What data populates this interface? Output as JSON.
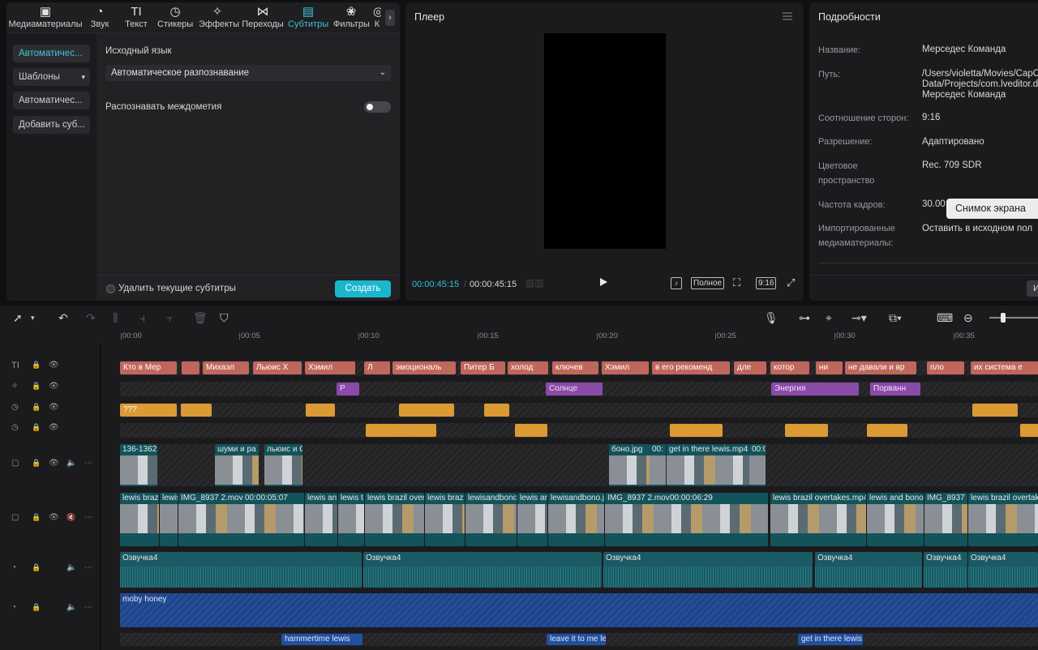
{
  "media_tabs": [
    {
      "label": "Медиаматериалы",
      "icon": "media-icon"
    },
    {
      "label": "Звук",
      "icon": "audio-icon"
    },
    {
      "label": "Текст",
      "icon": "text-icon"
    },
    {
      "label": "Стикеры",
      "icon": "sticker-icon"
    },
    {
      "label": "Эффекты",
      "icon": "effects-icon"
    },
    {
      "label": "Переходы",
      "icon": "transitions-icon"
    },
    {
      "label": "Субтитры",
      "icon": "captions-icon"
    },
    {
      "label": "Фильтры",
      "icon": "filters-icon"
    },
    {
      "label": "К",
      "icon": "more-icon"
    }
  ],
  "side_buttons": [
    "Автоматичес...",
    "Шаблоны",
    "Автоматичес...",
    "Добавить суб..."
  ],
  "captions": {
    "source_lang_label": "Исходный язык",
    "source_lang_value": "Автоматическое разпознавание",
    "interjections_label": "Распознавать междометия",
    "delete_label": "Удалить текущие субтитры",
    "create_label": "Создать"
  },
  "player": {
    "title": "Плеер",
    "time_current": "00:00:45:15",
    "time_total": "00:00:45:15",
    "full_label": "Полное",
    "ratio_label": "9:16"
  },
  "details": {
    "title": "Подробности",
    "rows": [
      {
        "label": "Название:",
        "value": "Мерседес Команда"
      },
      {
        "label": "Путь:",
        "value": "/Users/violetta/Movies/CapC"
      },
      {
        "label": "Соотношение сторон:",
        "value": "9:16"
      },
      {
        "label": "Разрешение:",
        "value": "Адаптировано"
      },
      {
        "label": "Цветовое пространство",
        "value": "Rec. 709 SDR"
      },
      {
        "label": "Частота кадров:",
        "value": "30.00"
      },
      {
        "label": "Импортированные медиаматериалы:",
        "value": "Оставить в исходном пол"
      }
    ],
    "path_line2": "Data/Projects/com.lveditor.d",
    "path_line3": "Мерседес Команда",
    "tooltip": "Снимок экрана",
    "footer_btn": "И"
  },
  "ruler": [
    "00:00",
    "00:05",
    "00:10",
    "00:15",
    "00:20",
    "00:25",
    "00:30",
    "00:35"
  ],
  "text_clips": [
    "Кто в Мер",
    "",
    "Михаэл",
    "Льюис Х",
    "Хэмил",
    "Л",
    "эмоциональ",
    "Питер Б",
    "холод",
    "ключев",
    "Хэмил",
    "в его рекоменд",
    "дле",
    "котор",
    "ни",
    "не давали и вр",
    "пло",
    "их система е"
  ],
  "fx_clips": [
    "Р",
    "Солнце",
    "Энергия",
    "Порванн"
  ],
  "sticker_clips_1": [
    "???",
    "",
    "",
    "",
    "",
    ""
  ],
  "sticker_clips_2": [
    "",
    "",
    "",
    "",
    "",
    ""
  ],
  "overlay_clips": [
    "136-13622",
    "шуми и ра",
    "льюис и С",
    "боно.jpg",
    "00:",
    "get in there lewis.mp4",
    "00:0"
  ],
  "main_clips": [
    "lewis braz",
    "lewis",
    "IMG_8937 2.mov",
    "00:00:05:07",
    "lewis an",
    "lewis t",
    "lewis brazil over",
    "lewis braz",
    "lewisandbono",
    "lewis ar",
    "lewisandbono.j",
    "IMG_8937 2.mov",
    "00:00:06:29",
    "lewis brazil overtakes.mp4",
    "lewis and bono",
    "IMG_8937 2",
    "lewis brazil overtakes"
  ],
  "voice_clips": [
    "Озвучка4",
    "Озвучка4",
    "Озвучка4",
    "Озвучка4",
    "Озвучка4",
    "Озвучка4"
  ],
  "music_clip": "moby honey",
  "sfx_clips": [
    "hammertime lewis",
    "leave it to me lei",
    "get in there lewis"
  ],
  "colors": {
    "accent": "#1bb6cc",
    "text_clip": "#c0675d",
    "effect_clip": "#8a4aa8",
    "sticker_clip": "#dc9a35"
  }
}
